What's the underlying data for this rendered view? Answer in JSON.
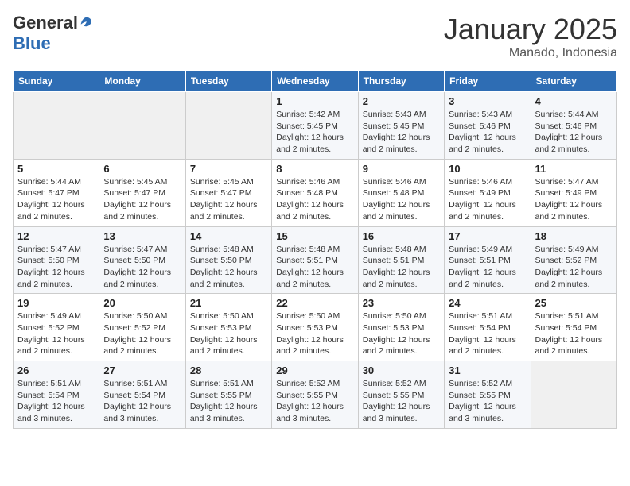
{
  "logo": {
    "general": "General",
    "blue": "Blue"
  },
  "header": {
    "title": "January 2025",
    "subtitle": "Manado, Indonesia"
  },
  "days_of_week": [
    "Sunday",
    "Monday",
    "Tuesday",
    "Wednesday",
    "Thursday",
    "Friday",
    "Saturday"
  ],
  "weeks": [
    [
      {
        "day": "",
        "info": ""
      },
      {
        "day": "",
        "info": ""
      },
      {
        "day": "",
        "info": ""
      },
      {
        "day": "1",
        "info": "Sunrise: 5:42 AM\nSunset: 5:45 PM\nDaylight: 12 hours\nand 2 minutes."
      },
      {
        "day": "2",
        "info": "Sunrise: 5:43 AM\nSunset: 5:45 PM\nDaylight: 12 hours\nand 2 minutes."
      },
      {
        "day": "3",
        "info": "Sunrise: 5:43 AM\nSunset: 5:46 PM\nDaylight: 12 hours\nand 2 minutes."
      },
      {
        "day": "4",
        "info": "Sunrise: 5:44 AM\nSunset: 5:46 PM\nDaylight: 12 hours\nand 2 minutes."
      }
    ],
    [
      {
        "day": "5",
        "info": "Sunrise: 5:44 AM\nSunset: 5:47 PM\nDaylight: 12 hours\nand 2 minutes."
      },
      {
        "day": "6",
        "info": "Sunrise: 5:45 AM\nSunset: 5:47 PM\nDaylight: 12 hours\nand 2 minutes."
      },
      {
        "day": "7",
        "info": "Sunrise: 5:45 AM\nSunset: 5:47 PM\nDaylight: 12 hours\nand 2 minutes."
      },
      {
        "day": "8",
        "info": "Sunrise: 5:46 AM\nSunset: 5:48 PM\nDaylight: 12 hours\nand 2 minutes."
      },
      {
        "day": "9",
        "info": "Sunrise: 5:46 AM\nSunset: 5:48 PM\nDaylight: 12 hours\nand 2 minutes."
      },
      {
        "day": "10",
        "info": "Sunrise: 5:46 AM\nSunset: 5:49 PM\nDaylight: 12 hours\nand 2 minutes."
      },
      {
        "day": "11",
        "info": "Sunrise: 5:47 AM\nSunset: 5:49 PM\nDaylight: 12 hours\nand 2 minutes."
      }
    ],
    [
      {
        "day": "12",
        "info": "Sunrise: 5:47 AM\nSunset: 5:50 PM\nDaylight: 12 hours\nand 2 minutes."
      },
      {
        "day": "13",
        "info": "Sunrise: 5:47 AM\nSunset: 5:50 PM\nDaylight: 12 hours\nand 2 minutes."
      },
      {
        "day": "14",
        "info": "Sunrise: 5:48 AM\nSunset: 5:50 PM\nDaylight: 12 hours\nand 2 minutes."
      },
      {
        "day": "15",
        "info": "Sunrise: 5:48 AM\nSunset: 5:51 PM\nDaylight: 12 hours\nand 2 minutes."
      },
      {
        "day": "16",
        "info": "Sunrise: 5:48 AM\nSunset: 5:51 PM\nDaylight: 12 hours\nand 2 minutes."
      },
      {
        "day": "17",
        "info": "Sunrise: 5:49 AM\nSunset: 5:51 PM\nDaylight: 12 hours\nand 2 minutes."
      },
      {
        "day": "18",
        "info": "Sunrise: 5:49 AM\nSunset: 5:52 PM\nDaylight: 12 hours\nand 2 minutes."
      }
    ],
    [
      {
        "day": "19",
        "info": "Sunrise: 5:49 AM\nSunset: 5:52 PM\nDaylight: 12 hours\nand 2 minutes."
      },
      {
        "day": "20",
        "info": "Sunrise: 5:50 AM\nSunset: 5:52 PM\nDaylight: 12 hours\nand 2 minutes."
      },
      {
        "day": "21",
        "info": "Sunrise: 5:50 AM\nSunset: 5:53 PM\nDaylight: 12 hours\nand 2 minutes."
      },
      {
        "day": "22",
        "info": "Sunrise: 5:50 AM\nSunset: 5:53 PM\nDaylight: 12 hours\nand 2 minutes."
      },
      {
        "day": "23",
        "info": "Sunrise: 5:50 AM\nSunset: 5:53 PM\nDaylight: 12 hours\nand 2 minutes."
      },
      {
        "day": "24",
        "info": "Sunrise: 5:51 AM\nSunset: 5:54 PM\nDaylight: 12 hours\nand 2 minutes."
      },
      {
        "day": "25",
        "info": "Sunrise: 5:51 AM\nSunset: 5:54 PM\nDaylight: 12 hours\nand 2 minutes."
      }
    ],
    [
      {
        "day": "26",
        "info": "Sunrise: 5:51 AM\nSunset: 5:54 PM\nDaylight: 12 hours\nand 3 minutes."
      },
      {
        "day": "27",
        "info": "Sunrise: 5:51 AM\nSunset: 5:54 PM\nDaylight: 12 hours\nand 3 minutes."
      },
      {
        "day": "28",
        "info": "Sunrise: 5:51 AM\nSunset: 5:55 PM\nDaylight: 12 hours\nand 3 minutes."
      },
      {
        "day": "29",
        "info": "Sunrise: 5:52 AM\nSunset: 5:55 PM\nDaylight: 12 hours\nand 3 minutes."
      },
      {
        "day": "30",
        "info": "Sunrise: 5:52 AM\nSunset: 5:55 PM\nDaylight: 12 hours\nand 3 minutes."
      },
      {
        "day": "31",
        "info": "Sunrise: 5:52 AM\nSunset: 5:55 PM\nDaylight: 12 hours\nand 3 minutes."
      },
      {
        "day": "",
        "info": ""
      }
    ]
  ]
}
